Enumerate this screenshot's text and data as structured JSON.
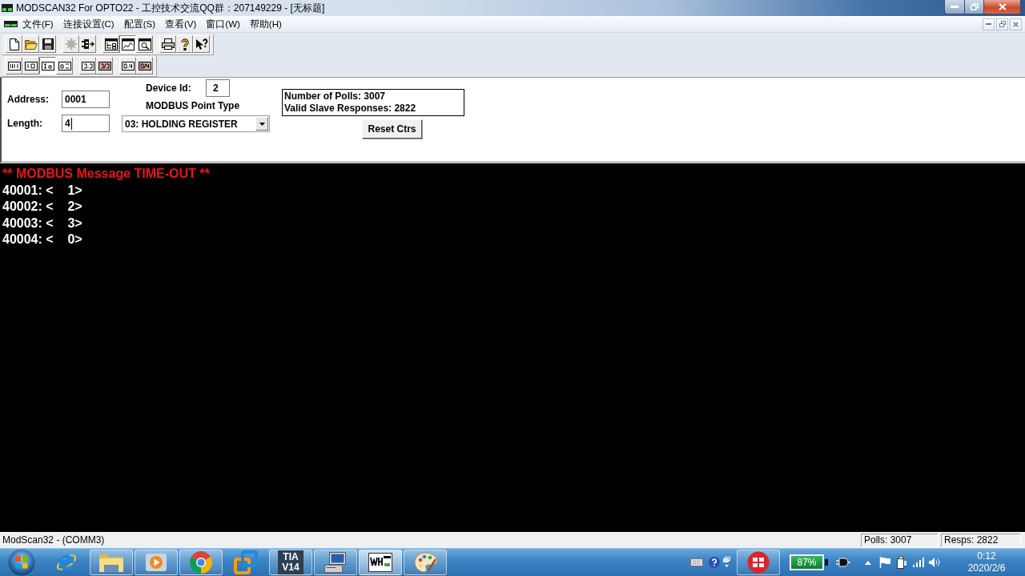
{
  "window": {
    "title": "MODSCAN32 For OPTO22 - 工控技术交流QQ群：207149229 - [无标题]"
  },
  "menu": [
    "文件(F)",
    "连接设置(C)",
    "配置(S)",
    "查看(V)",
    "窗口(W)",
    "帮助(H)"
  ],
  "toolbar": {
    "groups": [
      [
        {
          "kind": "new",
          "selected": false,
          "disabled": false
        },
        {
          "kind": "open",
          "selected": false,
          "disabled": false
        },
        {
          "kind": "save",
          "selected": false,
          "disabled": false
        }
      ],
      [
        {
          "kind": "connect",
          "selected": false,
          "disabled": true
        },
        {
          "kind": "disconnect",
          "selected": false,
          "disabled": false
        }
      ],
      [
        {
          "kind": "tree-window",
          "selected": false,
          "disabled": false
        },
        {
          "kind": "chart-window",
          "selected": true,
          "disabled": false
        },
        {
          "kind": "zoom-window",
          "selected": false,
          "disabled": false
        }
      ],
      [
        {
          "kind": "print",
          "selected": false,
          "disabled": false
        },
        {
          "kind": "help",
          "selected": false,
          "disabled": false
        },
        {
          "kind": "context-help",
          "selected": false,
          "disabled": false
        }
      ]
    ]
  },
  "format_toolbar": {
    "groups": [
      [
        {
          "kind": "binary",
          "selected": false
        },
        {
          "kind": "decimal",
          "selected": false
        },
        {
          "kind": "integer",
          "selected": true
        },
        {
          "kind": "hex",
          "selected": false
        }
      ],
      [
        {
          "kind": "float",
          "selected": false
        },
        {
          "kind": "swapped-float",
          "selected": false
        }
      ],
      [
        {
          "kind": "double",
          "selected": false
        },
        {
          "kind": "swapped-double",
          "selected": false
        }
      ]
    ]
  },
  "form": {
    "address": {
      "label": "Address:",
      "value": "0001"
    },
    "length": {
      "label": "Length:",
      "value": "4",
      "focused": true
    },
    "device_id": {
      "label": "Device Id:",
      "value": "2"
    },
    "point_type": {
      "label": "MODBUS Point Type",
      "value": "03: HOLDING REGISTER"
    },
    "counters": [
      "Number of Polls: 3007",
      "Valid Slave Responses: 2822"
    ],
    "reset_button": "Reset Ctrs"
  },
  "display": {
    "message": "** MODBUS Message TIME-OUT **",
    "rows": [
      "40001: <    1>",
      "40002: <    2>",
      "40003: <    3>",
      "40004: <    0>"
    ]
  },
  "status_bar": {
    "text": "ModScan32 - (COMM3)",
    "panels": [
      "Polls: 3007",
      "Resps: 2822"
    ]
  },
  "taskbar": {
    "apps": [
      {
        "kind": "e-browser",
        "running": false,
        "selected": false
      },
      {
        "kind": "folder",
        "running": true,
        "selected": false
      },
      {
        "kind": "player",
        "running": true,
        "selected": false
      },
      {
        "kind": "circle-browser",
        "running": true,
        "selected": false
      },
      {
        "kind": "squares",
        "running": false,
        "selected": false
      },
      {
        "kind": "tile",
        "label": "TIA V14",
        "running": true,
        "selected": false
      },
      {
        "kind": "computer",
        "running": true,
        "selected": false
      },
      {
        "kind": "logo",
        "running": true,
        "selected": true
      },
      {
        "kind": "palette",
        "running": true,
        "selected": false
      }
    ],
    "battery": "87%",
    "clock": {
      "time": "0:12",
      "date": "2020/2/6"
    }
  }
}
